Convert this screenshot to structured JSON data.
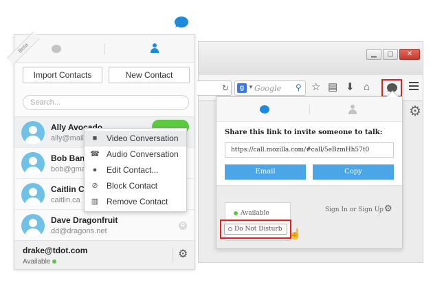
{
  "colors": {
    "brand_blue": "#1c8bdc",
    "available_green": "#5cc940",
    "highlight_red": "#e2211c",
    "action_blue": "#4ba6e8"
  },
  "left_panel": {
    "beta_label": "Beta",
    "tabs": [
      {
        "icon": "chat-bubble-icon"
      },
      {
        "icon": "person-icon"
      }
    ],
    "import_button": "Import Contacts",
    "new_contact_button": "New Contact",
    "search_placeholder": "Search...",
    "contacts": [
      {
        "name": "Ally Avocado",
        "email": "ally@mail.c"
      },
      {
        "name": "Bob Bana",
        "email": "bob@gmai"
      },
      {
        "name": "Caitlin Ca",
        "email": "caitlin.ca"
      },
      {
        "name": "Dave Dragonfruit",
        "email": "dd@dragons.net"
      }
    ],
    "context_menu": [
      {
        "icon": "video-camera-icon",
        "glyph": "■",
        "label": "Video Conversation"
      },
      {
        "icon": "phone-icon",
        "glyph": "☎",
        "label": "Audio Conversation"
      },
      {
        "icon": "person-edit-icon",
        "glyph": "●",
        "label": "Edit Contact..."
      },
      {
        "icon": "block-icon",
        "glyph": "⊘",
        "label": "Block Contact"
      },
      {
        "icon": "trash-icon",
        "glyph": "▥",
        "label": "Remove Contact"
      }
    ],
    "footer": {
      "user": "drake@tdot.com",
      "status": "Available"
    }
  },
  "browser": {
    "search_placeholder": "Google",
    "search_engine_letter": "g",
    "share_panel": {
      "title": "Share this link to invite someone to talk:",
      "link": "https://call.mozilla.com/#call/5eBzmHh57t0",
      "email_button": "Email",
      "copy_button": "Copy",
      "status_available": "Available",
      "do_not_disturb": "Do Not Disturb",
      "sign_in": "Sign In or Sign Up"
    }
  }
}
